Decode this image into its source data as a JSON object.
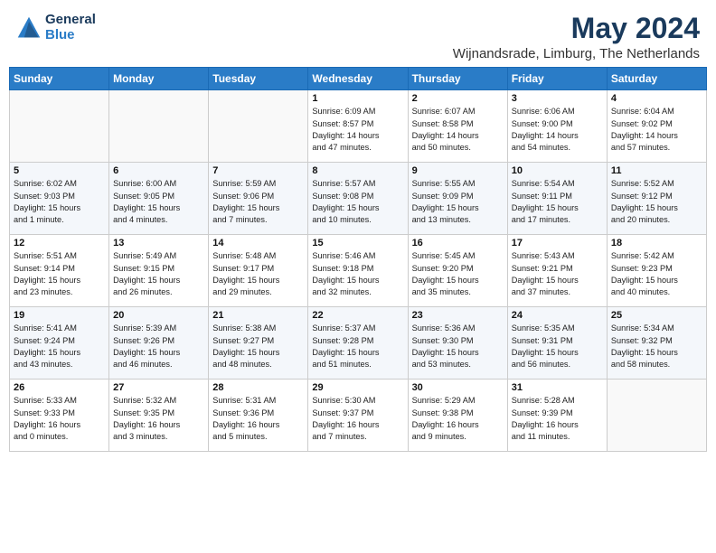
{
  "header": {
    "logo_general": "General",
    "logo_blue": "Blue",
    "month_year": "May 2024",
    "location": "Wijnandsrade, Limburg, The Netherlands"
  },
  "days_of_week": [
    "Sunday",
    "Monday",
    "Tuesday",
    "Wednesday",
    "Thursday",
    "Friday",
    "Saturday"
  ],
  "weeks": [
    [
      {
        "num": "",
        "info": ""
      },
      {
        "num": "",
        "info": ""
      },
      {
        "num": "",
        "info": ""
      },
      {
        "num": "1",
        "info": "Sunrise: 6:09 AM\nSunset: 8:57 PM\nDaylight: 14 hours\nand 47 minutes."
      },
      {
        "num": "2",
        "info": "Sunrise: 6:07 AM\nSunset: 8:58 PM\nDaylight: 14 hours\nand 50 minutes."
      },
      {
        "num": "3",
        "info": "Sunrise: 6:06 AM\nSunset: 9:00 PM\nDaylight: 14 hours\nand 54 minutes."
      },
      {
        "num": "4",
        "info": "Sunrise: 6:04 AM\nSunset: 9:02 PM\nDaylight: 14 hours\nand 57 minutes."
      }
    ],
    [
      {
        "num": "5",
        "info": "Sunrise: 6:02 AM\nSunset: 9:03 PM\nDaylight: 15 hours\nand 1 minute."
      },
      {
        "num": "6",
        "info": "Sunrise: 6:00 AM\nSunset: 9:05 PM\nDaylight: 15 hours\nand 4 minutes."
      },
      {
        "num": "7",
        "info": "Sunrise: 5:59 AM\nSunset: 9:06 PM\nDaylight: 15 hours\nand 7 minutes."
      },
      {
        "num": "8",
        "info": "Sunrise: 5:57 AM\nSunset: 9:08 PM\nDaylight: 15 hours\nand 10 minutes."
      },
      {
        "num": "9",
        "info": "Sunrise: 5:55 AM\nSunset: 9:09 PM\nDaylight: 15 hours\nand 13 minutes."
      },
      {
        "num": "10",
        "info": "Sunrise: 5:54 AM\nSunset: 9:11 PM\nDaylight: 15 hours\nand 17 minutes."
      },
      {
        "num": "11",
        "info": "Sunrise: 5:52 AM\nSunset: 9:12 PM\nDaylight: 15 hours\nand 20 minutes."
      }
    ],
    [
      {
        "num": "12",
        "info": "Sunrise: 5:51 AM\nSunset: 9:14 PM\nDaylight: 15 hours\nand 23 minutes."
      },
      {
        "num": "13",
        "info": "Sunrise: 5:49 AM\nSunset: 9:15 PM\nDaylight: 15 hours\nand 26 minutes."
      },
      {
        "num": "14",
        "info": "Sunrise: 5:48 AM\nSunset: 9:17 PM\nDaylight: 15 hours\nand 29 minutes."
      },
      {
        "num": "15",
        "info": "Sunrise: 5:46 AM\nSunset: 9:18 PM\nDaylight: 15 hours\nand 32 minutes."
      },
      {
        "num": "16",
        "info": "Sunrise: 5:45 AM\nSunset: 9:20 PM\nDaylight: 15 hours\nand 35 minutes."
      },
      {
        "num": "17",
        "info": "Sunrise: 5:43 AM\nSunset: 9:21 PM\nDaylight: 15 hours\nand 37 minutes."
      },
      {
        "num": "18",
        "info": "Sunrise: 5:42 AM\nSunset: 9:23 PM\nDaylight: 15 hours\nand 40 minutes."
      }
    ],
    [
      {
        "num": "19",
        "info": "Sunrise: 5:41 AM\nSunset: 9:24 PM\nDaylight: 15 hours\nand 43 minutes."
      },
      {
        "num": "20",
        "info": "Sunrise: 5:39 AM\nSunset: 9:26 PM\nDaylight: 15 hours\nand 46 minutes."
      },
      {
        "num": "21",
        "info": "Sunrise: 5:38 AM\nSunset: 9:27 PM\nDaylight: 15 hours\nand 48 minutes."
      },
      {
        "num": "22",
        "info": "Sunrise: 5:37 AM\nSunset: 9:28 PM\nDaylight: 15 hours\nand 51 minutes."
      },
      {
        "num": "23",
        "info": "Sunrise: 5:36 AM\nSunset: 9:30 PM\nDaylight: 15 hours\nand 53 minutes."
      },
      {
        "num": "24",
        "info": "Sunrise: 5:35 AM\nSunset: 9:31 PM\nDaylight: 15 hours\nand 56 minutes."
      },
      {
        "num": "25",
        "info": "Sunrise: 5:34 AM\nSunset: 9:32 PM\nDaylight: 15 hours\nand 58 minutes."
      }
    ],
    [
      {
        "num": "26",
        "info": "Sunrise: 5:33 AM\nSunset: 9:33 PM\nDaylight: 16 hours\nand 0 minutes."
      },
      {
        "num": "27",
        "info": "Sunrise: 5:32 AM\nSunset: 9:35 PM\nDaylight: 16 hours\nand 3 minutes."
      },
      {
        "num": "28",
        "info": "Sunrise: 5:31 AM\nSunset: 9:36 PM\nDaylight: 16 hours\nand 5 minutes."
      },
      {
        "num": "29",
        "info": "Sunrise: 5:30 AM\nSunset: 9:37 PM\nDaylight: 16 hours\nand 7 minutes."
      },
      {
        "num": "30",
        "info": "Sunrise: 5:29 AM\nSunset: 9:38 PM\nDaylight: 16 hours\nand 9 minutes."
      },
      {
        "num": "31",
        "info": "Sunrise: 5:28 AM\nSunset: 9:39 PM\nDaylight: 16 hours\nand 11 minutes."
      },
      {
        "num": "",
        "info": ""
      }
    ]
  ]
}
